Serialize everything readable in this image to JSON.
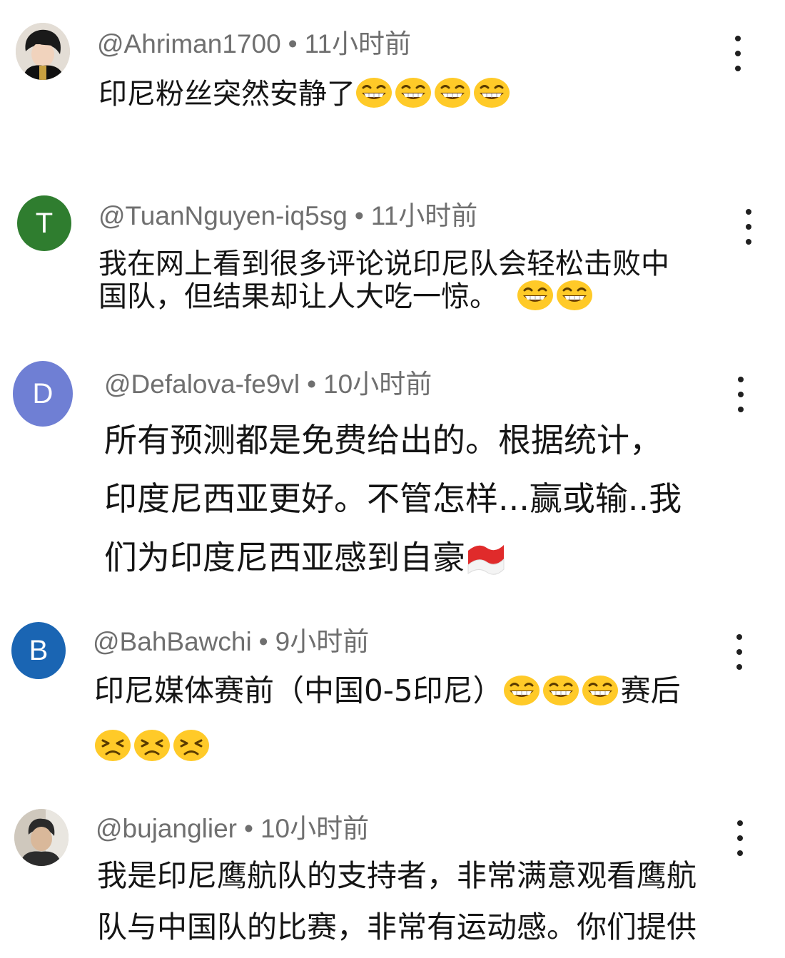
{
  "colors": {
    "meta_text": "#6f6f6f",
    "avatar_T": "#2f7d2f",
    "avatar_D": "#6f7fd4",
    "avatar_B": "#1a65b3",
    "emoji_face": "#ffca28"
  },
  "comments": [
    {
      "username": "@Ahriman1700",
      "time": "11小时前",
      "avatar_type": "photo",
      "lines": [
        "印尼粉丝突然安静了"
      ],
      "emojis": [
        "grinning-face-icon",
        "grinning-face-icon",
        "grinning-face-icon",
        "grinning-face-icon"
      ]
    },
    {
      "username": "@TuanNguyen-iq5sg",
      "time": "11小时前",
      "avatar_letter": "T",
      "lines": [
        "我在网上看到很多评论说印尼队会轻松击败中",
        "国队，但结果却让人大吃一惊。"
      ],
      "emojis": [
        "grinning-face-icon",
        "grinning-face-icon"
      ]
    },
    {
      "username": "@Defalova-fe9vl",
      "time": "10小时前",
      "avatar_letter": "D",
      "lines": [
        "所有预测都是免费给出的。根据统计，",
        "印度尼西亚更好。不管怎样...赢或输..我",
        "们为印度尼西亚感到自豪"
      ],
      "emojis": [
        "indonesia-flag-icon"
      ]
    },
    {
      "username": "@BahBawchi",
      "time": "9小时前",
      "avatar_letter": "B",
      "lines": [
        "印尼媒体赛前（中国0-5印尼）",
        "赛后"
      ],
      "emojis": [
        "grinning-face-icon",
        "grinning-face-icon",
        "grinning-face-icon",
        "persevering-face-icon",
        "persevering-face-icon",
        "persevering-face-icon"
      ]
    },
    {
      "username": "@bujanglier",
      "time": "10小时前",
      "avatar_type": "photo",
      "lines": [
        "我是印尼鹰航队的支持者，非常满意观看鹰航",
        "队与中国队的比赛，非常有运动感。你们提供"
      ],
      "emojis": []
    }
  ]
}
